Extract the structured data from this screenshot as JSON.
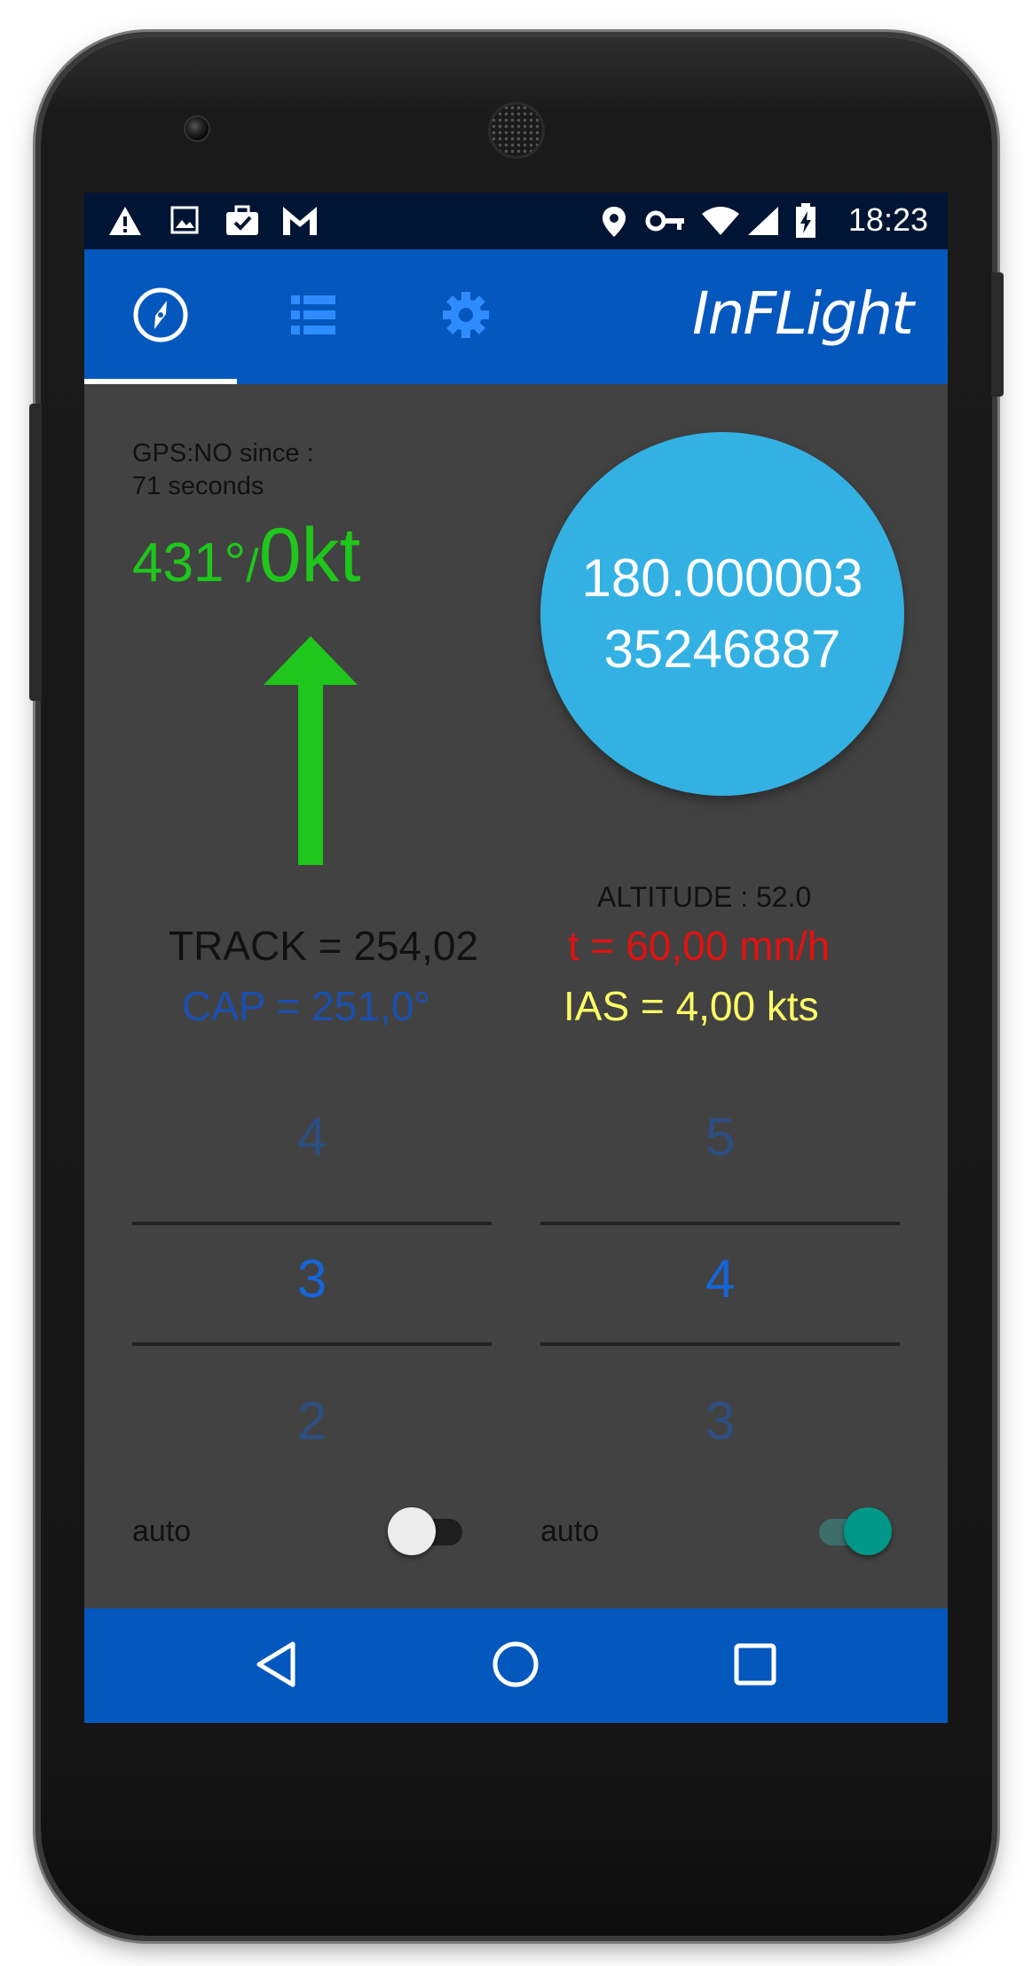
{
  "status_bar": {
    "left_icons": [
      "warning-icon",
      "image-icon",
      "briefcase-check-icon",
      "gmail-icon"
    ],
    "right_icons": [
      "location-pin-icon",
      "vpn-key-icon",
      "wifi-icon",
      "cellular-signal-icon",
      "battery-charging-icon"
    ],
    "time": "18:23"
  },
  "app_bar": {
    "tabs": [
      {
        "icon": "compass-icon",
        "selected": true
      },
      {
        "icon": "list-icon",
        "selected": false
      },
      {
        "icon": "gear-icon",
        "selected": false
      }
    ],
    "brand": "InFLight"
  },
  "main": {
    "gps_status": "GPS:NO since :\n71 seconds",
    "heading": "431°",
    "slash": "/",
    "speed": "0kt",
    "arrow_icon": "heading-arrow-icon",
    "coordinates_line1": "180.000003",
    "coordinates_line2": "35246887",
    "altitude": "ALTITUDE : 52.0",
    "track": "TRACK = 254,02",
    "cap": "CAP = 251,0°",
    "rate": "t = 60,00 mn/h",
    "ias": "IAS = 4,00 kts"
  },
  "pickers": [
    {
      "above": "4",
      "value": "3",
      "below": "2",
      "auto_label": "auto",
      "auto_on": false
    },
    {
      "above": "5",
      "value": "4",
      "below": "3",
      "auto_label": "auto",
      "auto_on": true
    }
  ],
  "colors": {
    "app_bar": "#0457bd",
    "status_bar": "#001433",
    "background": "#424242",
    "heading_green": "#1fc61b",
    "circle": "#34b1e3",
    "switch_on": "#009688"
  },
  "nav_bar": {
    "buttons": [
      "back-icon",
      "home-icon",
      "recents-icon"
    ]
  }
}
